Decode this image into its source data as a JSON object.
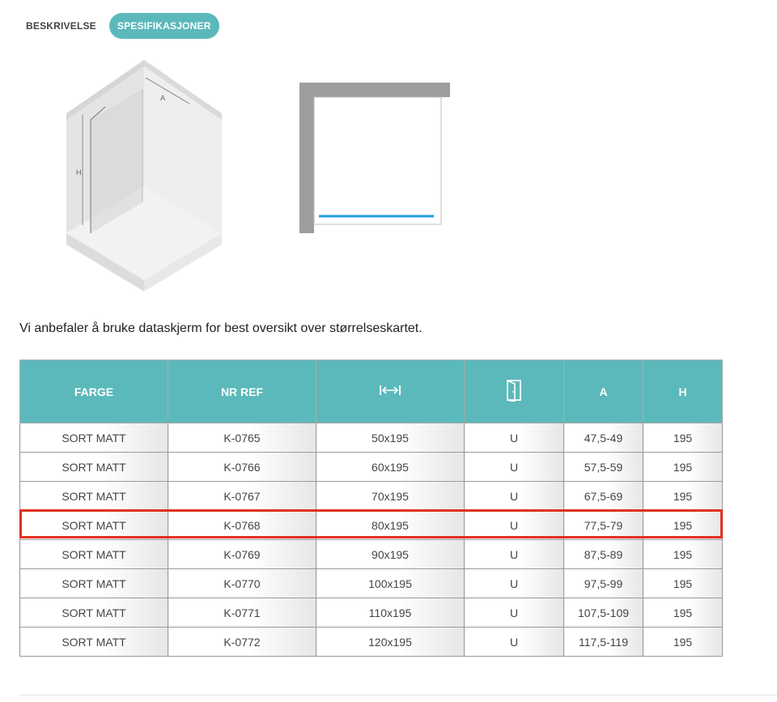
{
  "tabs": [
    {
      "label": "BESKRIVELSE",
      "active": false
    },
    {
      "label": "SPESIFIKASJONER",
      "active": true
    }
  ],
  "diagram": {
    "label_a": "A",
    "label_h": "H"
  },
  "note": "Vi anbefaler å bruke dataskjerm for best oversikt over størrelseskartet.",
  "table": {
    "headers": [
      "FARGE",
      "NR REF",
      "width-arrows-icon",
      "door-icon",
      "A",
      "H"
    ],
    "rows": [
      [
        "SORT MATT",
        "K-0765",
        "50x195",
        "U",
        "47,5-49",
        "195"
      ],
      [
        "SORT MATT",
        "K-0766",
        "60x195",
        "U",
        "57,5-59",
        "195"
      ],
      [
        "SORT MATT",
        "K-0767",
        "70x195",
        "U",
        "67,5-69",
        "195"
      ],
      [
        "SORT MATT",
        "K-0768",
        "80x195",
        "U",
        "77,5-79",
        "195"
      ],
      [
        "SORT MATT",
        "K-0769",
        "90x195",
        "U",
        "87,5-89",
        "195"
      ],
      [
        "SORT MATT",
        "K-0770",
        "100x195",
        "U",
        "97,5-99",
        "195"
      ],
      [
        "SORT MATT",
        "K-0771",
        "110x195",
        "U",
        "107,5-109",
        "195"
      ],
      [
        "SORT MATT",
        "K-0772",
        "120x195",
        "U",
        "117,5-119",
        "195"
      ]
    ],
    "highlighted_row": 3
  },
  "colors": {
    "accent": "#5cb9bb",
    "highlight": "#e03020",
    "glass_line": "#1e9fdc"
  }
}
